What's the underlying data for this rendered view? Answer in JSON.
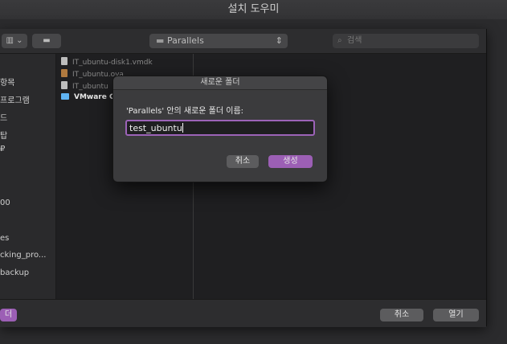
{
  "window": {
    "title": "설치 도우미"
  },
  "toolbar": {
    "path": "Parallels",
    "search_placeholder": "검색"
  },
  "sidebar": {
    "items": [
      "항목",
      "프로그램",
      "드",
      "탑",
      "₽",
      "00",
      "es",
      "cking_pro...",
      "backup"
    ]
  },
  "files": [
    {
      "name": "IT_ubuntu-disk1.vmdk",
      "kind": "doc"
    },
    {
      "name": "IT_ubuntu.ova",
      "kind": "package"
    },
    {
      "name": "IT_ubuntu",
      "kind": "doc"
    },
    {
      "name": "VMware C",
      "kind": "folder"
    }
  ],
  "bottom": {
    "new_folder_label": "더",
    "cancel_label": "취소",
    "open_label": "열기"
  },
  "dialog": {
    "title": "새로운 폴더",
    "prompt": "'Parallels' 안의 새로운 폴더 이름:",
    "value": "test_ubuntu",
    "cancel_label": "취소",
    "create_label": "생성"
  },
  "colors": {
    "accent": "#9c5fb5",
    "folder": "#5fb3f2"
  }
}
